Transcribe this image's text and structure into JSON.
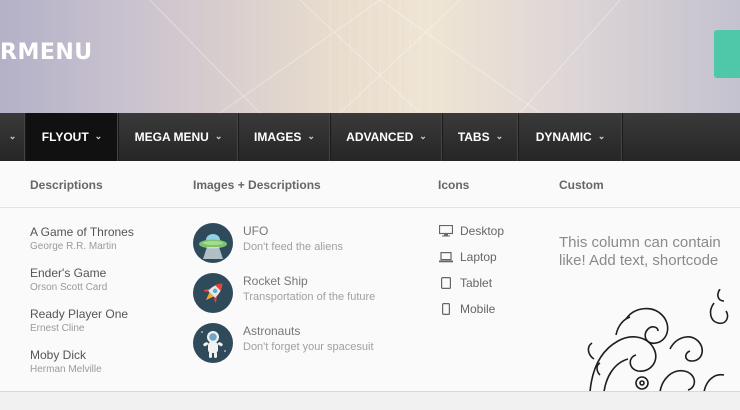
{
  "brand": {
    "text": "RMENU"
  },
  "nav": {
    "items": [
      {
        "label": "FLYOUT"
      },
      {
        "label": "MEGA MENU"
      },
      {
        "label": "IMAGES"
      },
      {
        "label": "ADVANCED"
      },
      {
        "label": "TABS"
      },
      {
        "label": "DYNAMIC"
      }
    ]
  },
  "dropdown": {
    "columns": {
      "descriptions": "Descriptions",
      "images": "Images + Descriptions",
      "icons": "Icons",
      "custom": "Custom"
    },
    "books": [
      {
        "title": "A Game of Thrones",
        "author": "George R.R. Martin"
      },
      {
        "title": "Ender's Game",
        "author": "Orson Scott Card"
      },
      {
        "title": "Ready Player One",
        "author": "Ernest Cline"
      },
      {
        "title": "Moby Dick",
        "author": "Herman Melville"
      }
    ],
    "features": [
      {
        "title": "UFO",
        "desc": "Don't feed the aliens",
        "icon": "ufo-icon"
      },
      {
        "title": "Rocket Ship",
        "desc": "Transportation of the future",
        "icon": "rocket-icon"
      },
      {
        "title": "Astronauts",
        "desc": "Don't forget your spacesuit",
        "icon": "astronaut-icon"
      }
    ],
    "devices": [
      {
        "label": "Desktop",
        "icon": "desktop-icon"
      },
      {
        "label": "Laptop",
        "icon": "laptop-icon"
      },
      {
        "label": "Tablet",
        "icon": "tablet-icon"
      },
      {
        "label": "Mobile",
        "icon": "mobile-icon"
      }
    ],
    "custom": {
      "line1": "This column can contain",
      "line2": "like! Add text, shortcode"
    }
  },
  "colors": {
    "accent": "#4fc8a8",
    "navbar": "#2e2e2e",
    "active": "#111111"
  }
}
